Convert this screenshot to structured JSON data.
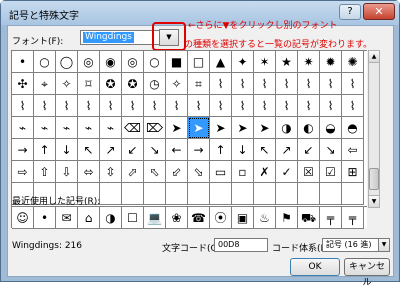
{
  "window": {
    "title": "記号と特殊文字",
    "help_label": "?",
    "close_label": "✕"
  },
  "font": {
    "label": "フォント(F):",
    "value": "Wingdings",
    "dropdown_glyph": "▼"
  },
  "annotations": {
    "line1": "←さらに▼をクリックし別のフォント",
    "line2": "の種類を選択すると一覧の記号が変わります。",
    "highlight_color": "#e00000"
  },
  "symbol_grid": [
    [
      "•",
      "○",
      "◯",
      "◎",
      "◉",
      "◎",
      "○",
      "■",
      "□",
      "▲",
      "✦",
      "✶",
      "★",
      "✷",
      "✹",
      "✺"
    ],
    [
      "✣",
      "⌖",
      "✧",
      "⌑",
      "✪",
      "✪",
      "◷",
      "✧",
      "⌗",
      "⌇",
      "⌇",
      "⌇",
      "⌇",
      "⌇",
      "⌇",
      "⌇"
    ],
    [
      "⌇",
      "⌇",
      "⌇",
      "⌇",
      "⌇",
      "⌇",
      "⌇",
      "⌇",
      "⌇",
      "⌇",
      "⌇",
      "⌇",
      "⌇",
      "⌇",
      "⌇",
      "⌇"
    ],
    [
      "⌁",
      "⌁",
      "⌁",
      "⌁",
      "⌁",
      "⌫",
      "⌦",
      "➤",
      "➤",
      "➤",
      "➤",
      "➤",
      "◑",
      "◐",
      "◒",
      "◓"
    ],
    [
      "→",
      "↑",
      "↓",
      "↖",
      "↗",
      "↙",
      "↘",
      "←",
      "→",
      "↑",
      "↓",
      "↖",
      "↗",
      "↙",
      "↘",
      "⇦"
    ],
    [
      "⇨",
      "⇧",
      "⇩",
      "⬄",
      "⇳",
      "⬀",
      "⬁",
      "⬃",
      "⬂",
      "▭",
      "▫",
      "✗",
      "✓",
      "☒",
      "☑",
      "⊞"
    ],
    [
      "",
      "",
      "",
      "",
      "",
      "",
      "",
      "",
      "",
      "",
      "",
      "",
      "",
      "",
      "",
      ""
    ]
  ],
  "selected_cell": {
    "row": 3,
    "col": 8
  },
  "scroll": {
    "up": "▲",
    "down": "▼"
  },
  "recent": {
    "label": "最近使用した記号(R):",
    "symbols": [
      "☺",
      "•",
      "✉",
      "⌂",
      "◑",
      "☐",
      "💻",
      "❀",
      "☎",
      "⦿",
      "▣",
      "♨",
      "⚑",
      "⛟",
      "╤",
      "╤"
    ]
  },
  "status": {
    "font_code": "Wingdings: 216",
    "code_label": "文字コード(C):",
    "code_value": "00D8",
    "system_label": "コード体系(M):",
    "system_value": "記号 (16 進)",
    "system_arrow": "▼"
  },
  "buttons": {
    "ok": "OK",
    "cancel": "キャンセル"
  }
}
